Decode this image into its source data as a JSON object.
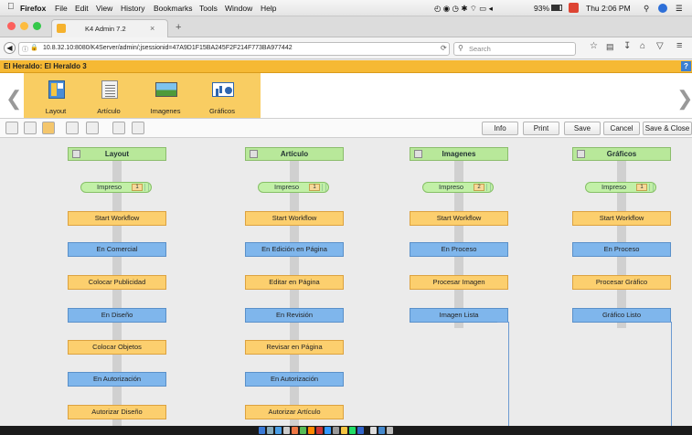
{
  "menubar": {
    "app": "Firefox",
    "items": [
      "File",
      "Edit",
      "View",
      "History",
      "Bookmarks",
      "Tools",
      "Window",
      "Help"
    ],
    "battery": "93%",
    "clock": "Thu 2:06 PM"
  },
  "tab": {
    "title": "K4 Admin 7.2",
    "close": "×",
    "new": "+"
  },
  "url": {
    "address": "10.8.32.10:8080/K4Server/admin/;jsessionid=47A9D1F15BA245F2F214F773BA977442",
    "search_placeholder": "Search"
  },
  "titlebar": {
    "title": "El Heraldo: El Heraldo 3",
    "help": "?"
  },
  "nav": {
    "items": [
      {
        "label": "Layout",
        "icon": "layout-icon"
      },
      {
        "label": "Artículo",
        "icon": "article-icon"
      },
      {
        "label": "Imagenes",
        "icon": "image-icon"
      },
      {
        "label": "Gráficos",
        "icon": "chart-icon"
      }
    ]
  },
  "toolbar": {
    "info": "Info",
    "print": "Print",
    "save": "Save",
    "cancel": "Cancel",
    "save_close": "Save & Close"
  },
  "columns": [
    {
      "header": "Layout",
      "pill": "Impreso",
      "count": "1",
      "steps": [
        "Start Workflow",
        "En Comercial",
        "Colocar Publicidad",
        "En Diseño",
        "Colocar Objetos",
        "En Autorización",
        "Autorizar Diseño"
      ]
    },
    {
      "header": "Artículo",
      "pill": "Impreso",
      "count": "1",
      "steps": [
        "Start Workflow",
        "En Edición en Página",
        "Editar en Página",
        "En Revisión",
        "Revisar en Página",
        "En Autorización",
        "Autorizar Artículo"
      ]
    },
    {
      "header": "Imagenes",
      "pill": "Impreso",
      "count": "2",
      "steps": [
        "Start Workflow",
        "En Proceso",
        "Procesar Imagen",
        "Imagen Lista"
      ]
    },
    {
      "header": "Gráficos",
      "pill": "Impreso",
      "count": "1",
      "steps": [
        "Start Workflow",
        "En Proceso",
        "Procesar Gráfico",
        "Gráfico Listo"
      ]
    }
  ],
  "colors": {
    "accent": "#f6b934",
    "nav_panel": "#f9cd62",
    "orange_step": "#fccf6e",
    "blue_step": "#7fb6ec",
    "header_green": "#b8e89a"
  }
}
